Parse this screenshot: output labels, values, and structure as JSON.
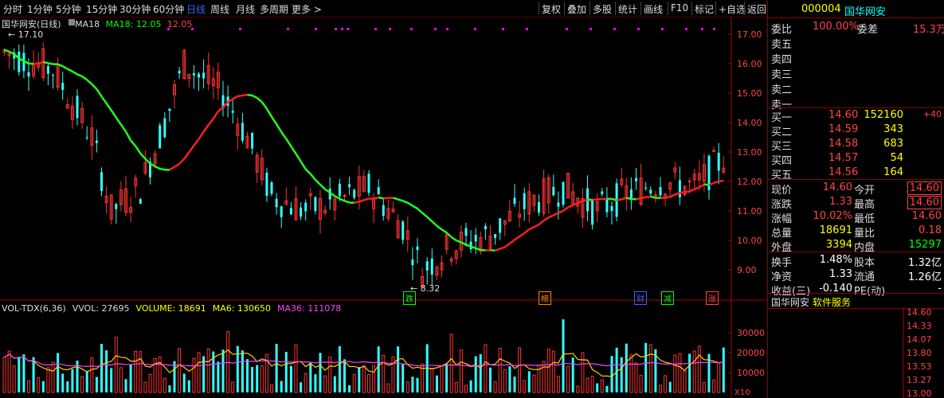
{
  "toolbar": {
    "periods": [
      "分时",
      "1分钟",
      "5分钟",
      "15分钟",
      "30分钟",
      "60分钟",
      "日线",
      "周线",
      "月线",
      "多周期",
      "更多 >"
    ],
    "active": "日线",
    "right_items": [
      "复权",
      "叠加",
      "多股",
      "统计",
      "画线",
      "F10",
      "标记",
      "+自选",
      "返回"
    ]
  },
  "chart": {
    "stock_label": "国华网安(日线)",
    "ma_label": "MA18",
    "ma_value_label": "MA18: 12.05",
    "ma_value2": "12.05",
    "high_mark": "17.10",
    "low_mark": "8.32",
    "price_ticks": [
      "17.00",
      "16.00",
      "15.00",
      "14.00",
      "13.00",
      "12.00",
      "11.00",
      "10.00",
      "9.00"
    ],
    "markers": [
      {
        "text": "跌",
        "color": "#0f0"
      },
      {
        "text": "榜",
        "color": "#f80"
      },
      {
        "text": "财",
        "color": "#36f"
      },
      {
        "text": "减",
        "color": "#0f0"
      },
      {
        "text": "涨",
        "color": "#f44"
      }
    ]
  },
  "volume": {
    "title_items": [
      "VOL-TDX(6,36)",
      "VVOL: 27695",
      "VOLUME: 18691",
      "MA6: 130650",
      "MA36: 111078"
    ],
    "ticks": [
      "30000",
      "20000",
      "10000"
    ],
    "x10": "X10"
  },
  "panel": {
    "code": "000004",
    "name": "国华网安",
    "wei_bi_label": "委比",
    "wei_bi": "100.00%",
    "wei_cha_label": "委差",
    "wei_cha": "15.3万",
    "sell": [
      "卖五",
      "卖四",
      "卖三",
      "卖二",
      "卖一"
    ],
    "buy": [
      {
        "label": "买一",
        "price": "14.60",
        "vol": "152160",
        "chg": "+40"
      },
      {
        "label": "买二",
        "price": "14.59",
        "vol": "343",
        "chg": ""
      },
      {
        "label": "买三",
        "price": "14.58",
        "vol": "683",
        "chg": ""
      },
      {
        "label": "买四",
        "price": "14.57",
        "vol": "54",
        "chg": ""
      },
      {
        "label": "买五",
        "price": "14.56",
        "vol": "164",
        "chg": ""
      }
    ],
    "stats": [
      {
        "l1": "现价",
        "v1": "14.60",
        "l2": "今开",
        "v2": "14.60"
      },
      {
        "l1": "涨跌",
        "v1": "1.33",
        "l2": "最高",
        "v2": "14.60"
      },
      {
        "l1": "涨幅",
        "v1": "10.02%",
        "l2": "最低",
        "v2": "14.60"
      },
      {
        "l1": "总量",
        "v1": "18691",
        "l2": "量比",
        "v2": "0.18"
      },
      {
        "l1": "外盘",
        "v1": "3394",
        "l2": "内盘",
        "v2": "15297"
      }
    ],
    "stats2": [
      {
        "l1": "换手",
        "v1": "1.48%",
        "l2": "股本",
        "v2": "1.32亿"
      },
      {
        "l1": "净资",
        "v1": "1.33",
        "l2": "流通",
        "v2": "1.26亿"
      },
      {
        "l1": "收益(三)",
        "v1": "-0.140",
        "l2": "PE(动)",
        "v2": "-"
      }
    ],
    "tabs": [
      "国华网安",
      "软件服务"
    ],
    "mini_ticks": [
      "14.60",
      "14.33",
      "14.07",
      "13.80",
      "13.53",
      "13.27",
      "13.00"
    ]
  },
  "colors": {
    "up": "#ff3333",
    "down": "#33ffff",
    "ma_up": "#ff2020",
    "ma_down": "#20ff20",
    "vol_ma6": "#ffcc00",
    "vol_ma36": "#ff40ff"
  }
}
